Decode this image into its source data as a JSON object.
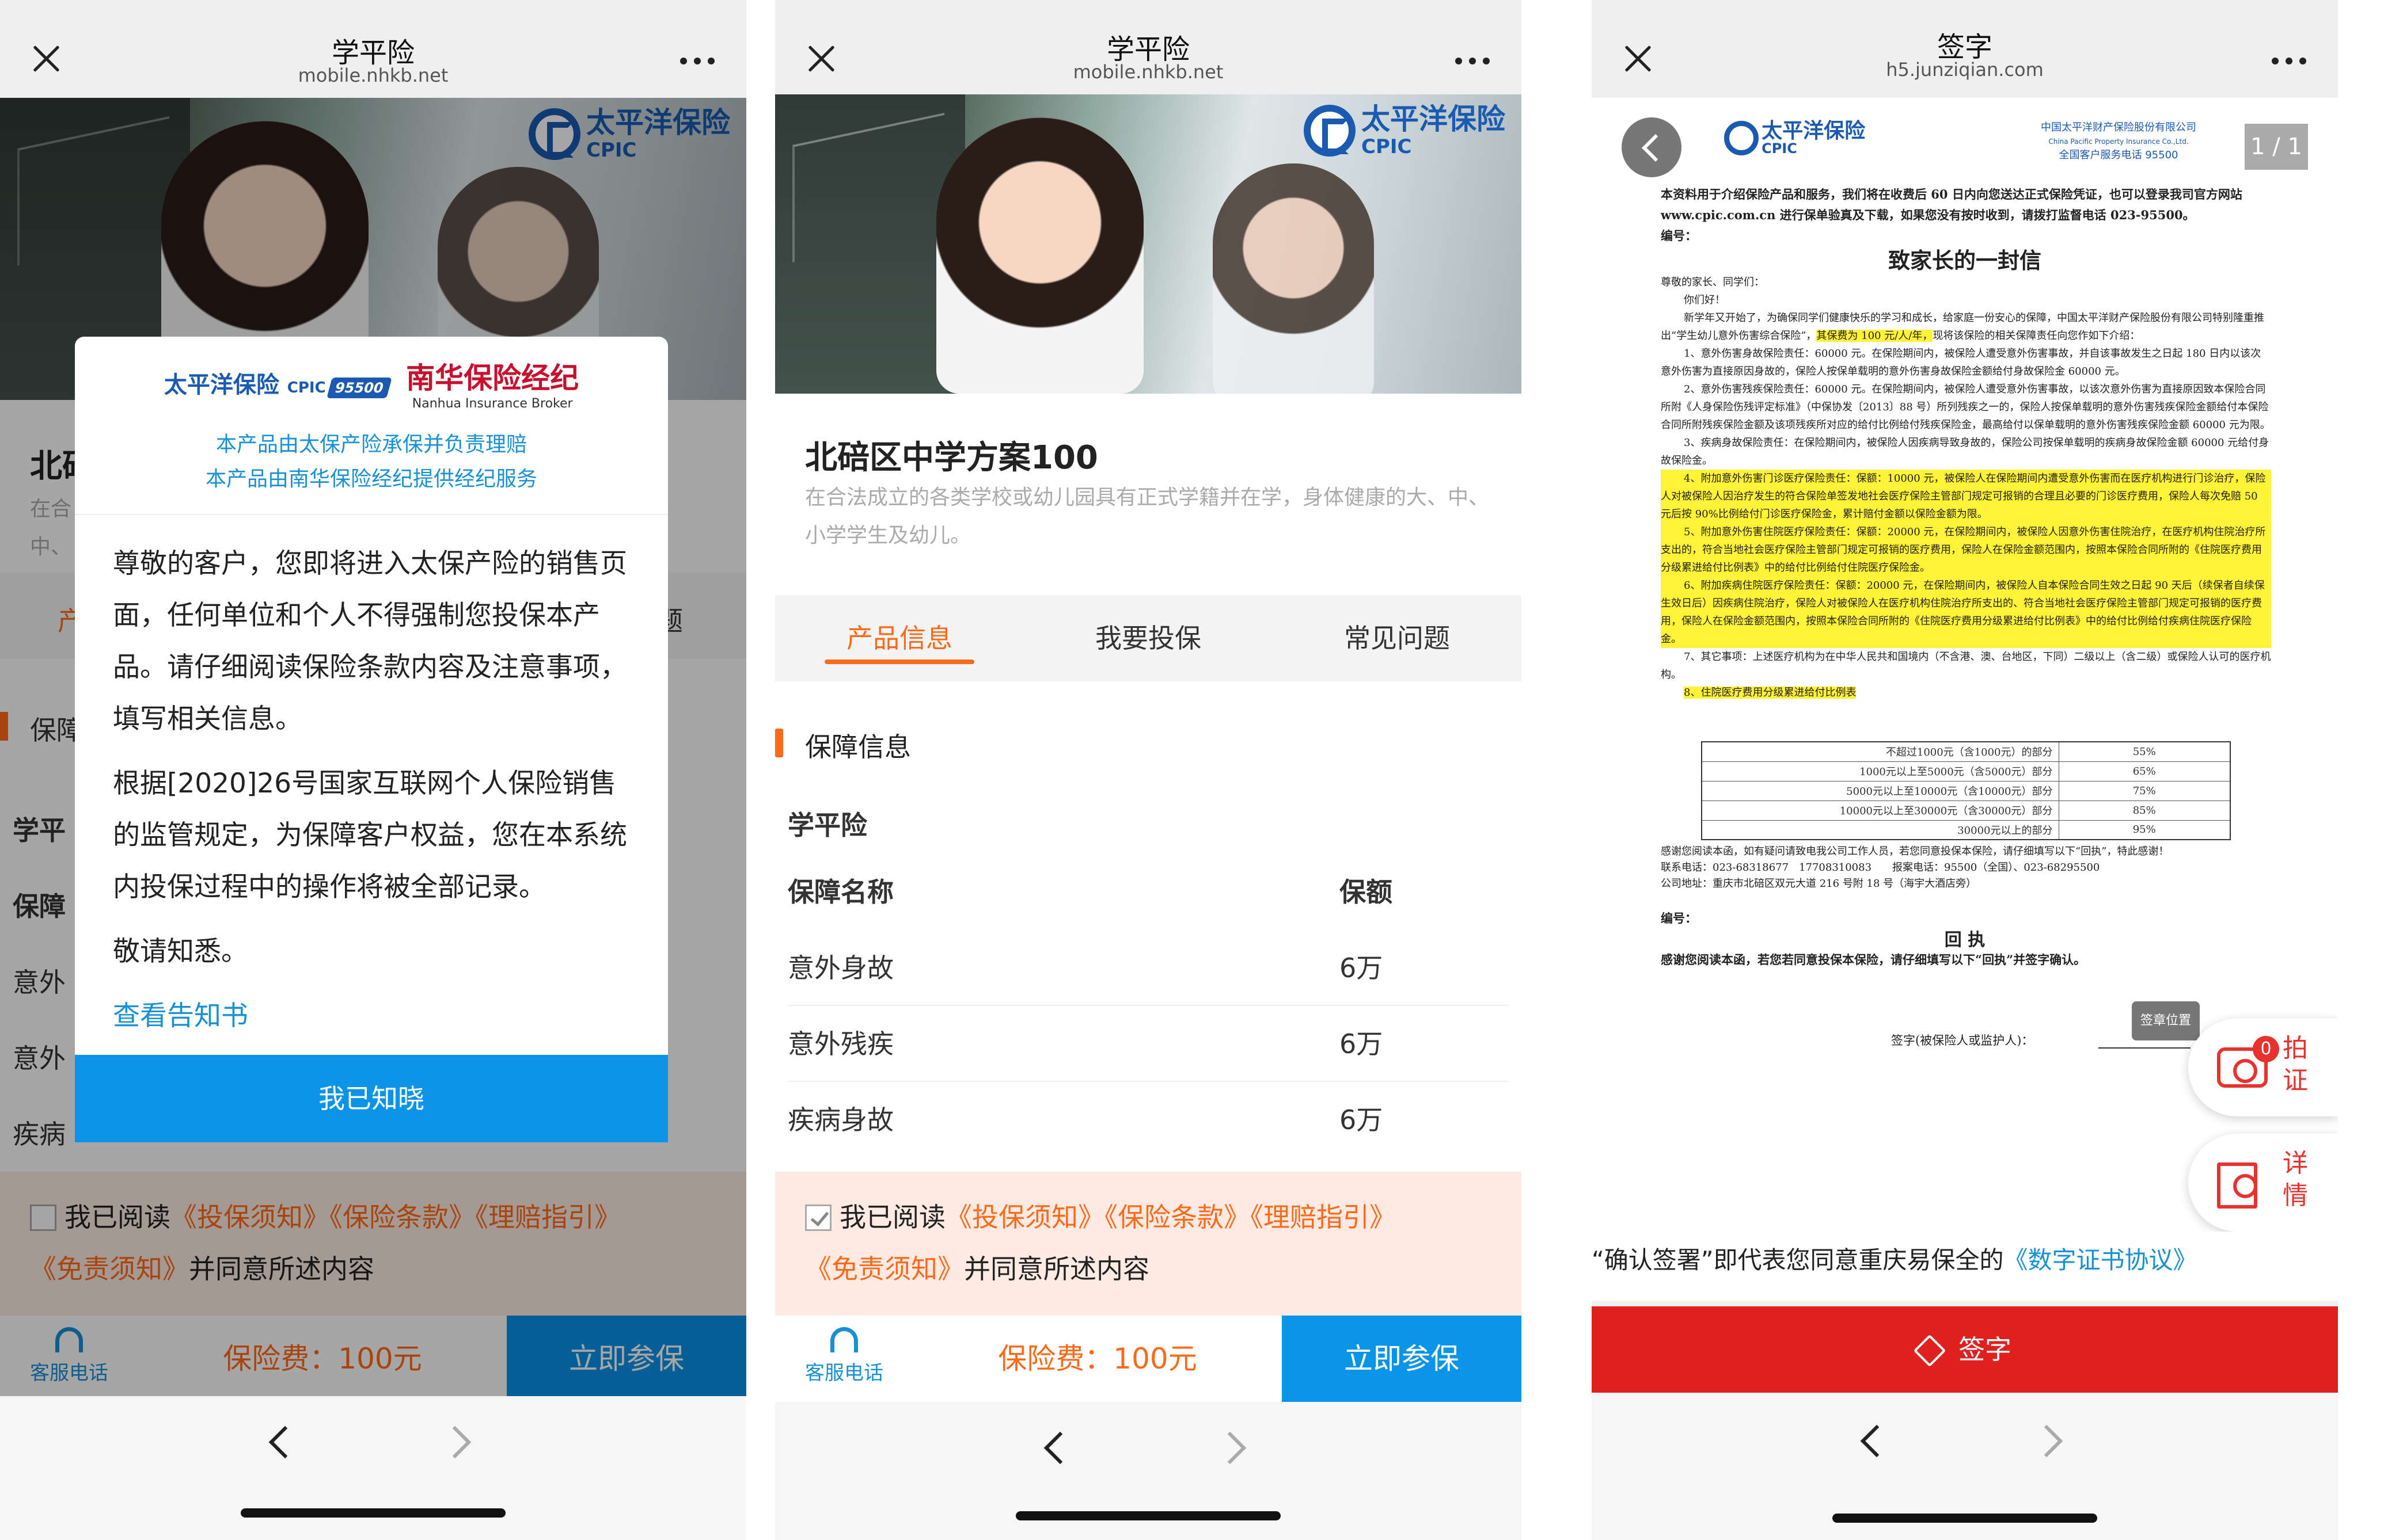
{
  "phone1": {
    "title": "学平险",
    "url": "mobile.nhkb.net",
    "hero_brand_zh": "太平洋保险",
    "hero_brand_en": "CPIC",
    "bg_title": "北碚",
    "bg_desc": "在合",
    "bg_desc2": "中、",
    "bg_tab": "产",
    "bg_tab3": "题",
    "bg_section": "保障",
    "bg_sub": "学平",
    "bg_col": "保障",
    "bg_row1": "意外",
    "bg_row2": "意外",
    "bg_row3": "疾病",
    "modal": {
      "logo1": "太平洋保险",
      "logo1_en": "CPIC",
      "logo1_tag": "95500",
      "logo2": "南华保险经纪",
      "logo2_en": "Nanhua Insurance Broker",
      "line1": "本产品由太保产险承保并负责理赔",
      "line2": "本产品由南华保险经纪提供经纪服务",
      "para1": "尊敬的客户，您即将进入太保产险的销售页面，任何单位和个人不得强制您投保本产品。请仔细阅读保险条款内容及注意事项，填写相关信息。",
      "para2": "根据[2020]26号国家互联网个人保险销售的监管规定，为保障客户权益，您在本系统内投保过程中的操作将被全部记录。",
      "para3": "敬请知悉。",
      "link": "查看告知书",
      "ok": "我已知晓"
    }
  },
  "phone2": {
    "title": "学平险",
    "url": "mobile.nhkb.net",
    "hero_brand_zh": "太平洋保险",
    "hero_brand_en": "CPIC",
    "product_title": "北碚区中学方案100",
    "product_desc": "在合法成立的各类学校或幼儿园具有正式学籍并在学，身体健康的大、中、小学学生及幼儿。",
    "tabs": [
      "产品信息",
      "我要投保",
      "常见问题"
    ],
    "section": "保障信息",
    "subheading": "学平险",
    "col_name": "保障名称",
    "col_amount": "保额",
    "rows": [
      {
        "name": "意外身故",
        "amount": "6万"
      },
      {
        "name": "意外残疾",
        "amount": "6万"
      },
      {
        "name": "疾病身故",
        "amount": "6万"
      }
    ]
  },
  "agree": {
    "pre": "我已阅读",
    "l1": "《投保须知》",
    "l2": "《保险条款》",
    "l3": "《理赔指引》",
    "l4": "《免责须知》",
    "post": "并同意所述内容"
  },
  "bottom": {
    "service": "客服电话",
    "fee": "保险费：100元",
    "go": "立即参保"
  },
  "phone3": {
    "title": "签字",
    "url": "h5.junziqian.com",
    "page": "1 / 1",
    "doc_logo": "太平洋保险",
    "doc_logo_en": "CPIC",
    "doc_company_zh": "中国太平洋财产保险股份有限公司",
    "doc_company_en": "China Pacific Property Insurance Co.,Ltd.",
    "doc_hotline": "全国客户服务电话 95500",
    "intro": "本资料用于介绍保险产品和服务，我们将在收费后 60 日内向您送达正式保险凭证，也可以登录我司官方网站 www.cpic.com.cn 进行保单验真及下载，如果您没有按时收到，请拨打监督电话 023-95500。",
    "no": "编号：",
    "letter_title": "致家长的一封信",
    "greet": "尊敬的家长、同学们：",
    "hello": "你们好！",
    "p1": "新学年又开始了，为确保同学们健康快乐的学习和成长，给家庭一份安心的保障，中国太平洋财产保险股份有限公司特别隆重推出“学生幼儿意外伤害综合保险”，",
    "p1_hl": "其保费为 100 元/人/年，",
    "p1_end": "现将该保险的相关保障责任向您作如下介绍：",
    "i1": "1、意外伤害身故保险责任：60000 元。在保险期间内，被保险人遭受意外伤害事故，并自该事故发生之日起 180 日内以该次意外伤害为直接原因身故的，保险人按保单载明的意外伤害身故保险金额给付身故保险金 60000 元。",
    "i2": "2、意外伤害残疾保险责任：60000 元。在保险期间内，被保险人遭受意外伤害事故，以该次意外伤害为直接原因致本保险合同所附《人身保险伤残评定标准》（中保协发〔2013〕88 号）所列残疾之一的，保险人按保单载明的意外伤害残疾保险金额给付本保险合同所附残疾保险金额及该项残疾所对应的给付比例给付残疾保险金，最高给付以保单载明的意外伤害残疾保险金额 60000 元为限。",
    "i3": "3、疾病身故保险责任：在保险期间内，被保险人因疾病导致身故的，保险公司按保单载明的疾病身故保险金额 60000 元给付身故保险金。",
    "i4": "4、附加意外伤害门诊医疗保险责任：保额：10000 元，被保险人在保险期间内遭受意外伤害而在医疗机构进行门诊治疗，保险人对被保险人因治疗发生的符合保险单签发地社会医疗保险主管部门规定可报销的合理且必要的门诊医疗费用，保险人每次免赔 50 元后按 90%比例给付门诊医疗保险金，累计赔付金额以保险金额为限。",
    "i5": "5、附加意外伤害住院医疗保险责任：保额：20000 元，在保险期间内，被保险人因意外伤害住院治疗，在医疗机构住院治疗所支出的，符合当地社会医疗保险主管部门规定可报销的医疗费用，保险人在保险金额范围内，按照本保险合同所附的《住院医疗费用分级累进给付比例表》中的给付比例给付住院医疗保险金。",
    "i6": "6、附加疾病住院医疗保险责任：保额：20000 元，在保险期间内，被保险人自本保险合同生效之日起 90 天后（续保者自续保生效日后）因疾病住院治疗，保险人对被保险人在医疗机构住院治疗所支出的、符合当地社会医疗保险主管部门规定可报销的医疗费用，保险人在保险金额范围内，按照本保险合同所附的《住院医疗费用分级累进给付比例表》中的给付比例给付疾病住院医疗保险金。",
    "i7": "7、其它事项：上述医疗机构为在中华人民共和国境内（不含港、澳、台地区，下同）二级以上（含二级）或保险人认可的医疗机构。",
    "i8": "8、住院医疗费用分级累进给付比例表",
    "ratio": [
      {
        "range": "不超过1000元（含1000元）的部分",
        "pct": "55%"
      },
      {
        "range": "1000元以上至5000元（含5000元）部分",
        "pct": "65%"
      },
      {
        "range": "5000元以上至10000元（含10000元）部分",
        "pct": "75%"
      },
      {
        "range": "10000元以上至30000元（含30000元）部分",
        "pct": "85%"
      },
      {
        "range": "30000元以上的部分",
        "pct": "95%"
      }
    ],
    "thanks": "感谢您阅读本函，如有疑问请致电我公司工作人员，若您同意投保本保险，请仔细填写以下“回执”，特此感谢！",
    "contact": "联系电话：023-68318677　17708310083　　报案电话：95500（全国）、023-68295500",
    "addr": "公司地址：重庆市北碚区双元大道 216 号附 18 号（海宇大酒店旁）",
    "no2": "编号：",
    "receipt": "回 执",
    "receipt_text": "感谢您阅读本函，若您若同意投保本保险，请仔细填写以下“回执”并签字确认。",
    "sign_label": "签字(被保险人或监护人)：",
    "stamp": "签章位置",
    "float1": "拍证",
    "float1_badge": "0",
    "float2": "详情",
    "confirm_text": "“确认签署”即代表您同意重庆易保全的",
    "confirm_link": "《数字证书协议》",
    "sign_btn": "签字"
  }
}
